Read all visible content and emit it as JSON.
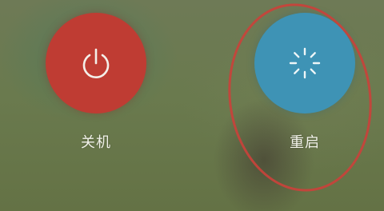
{
  "power_menu": {
    "poweroff": {
      "label": "关机",
      "icon": "power-icon",
      "color": "#bf3c33"
    },
    "restart": {
      "label": "重启",
      "icon": "loading-spinner-icon",
      "color": "#3e93b5"
    }
  },
  "annotation": {
    "highlight_color": "#c9423b"
  }
}
